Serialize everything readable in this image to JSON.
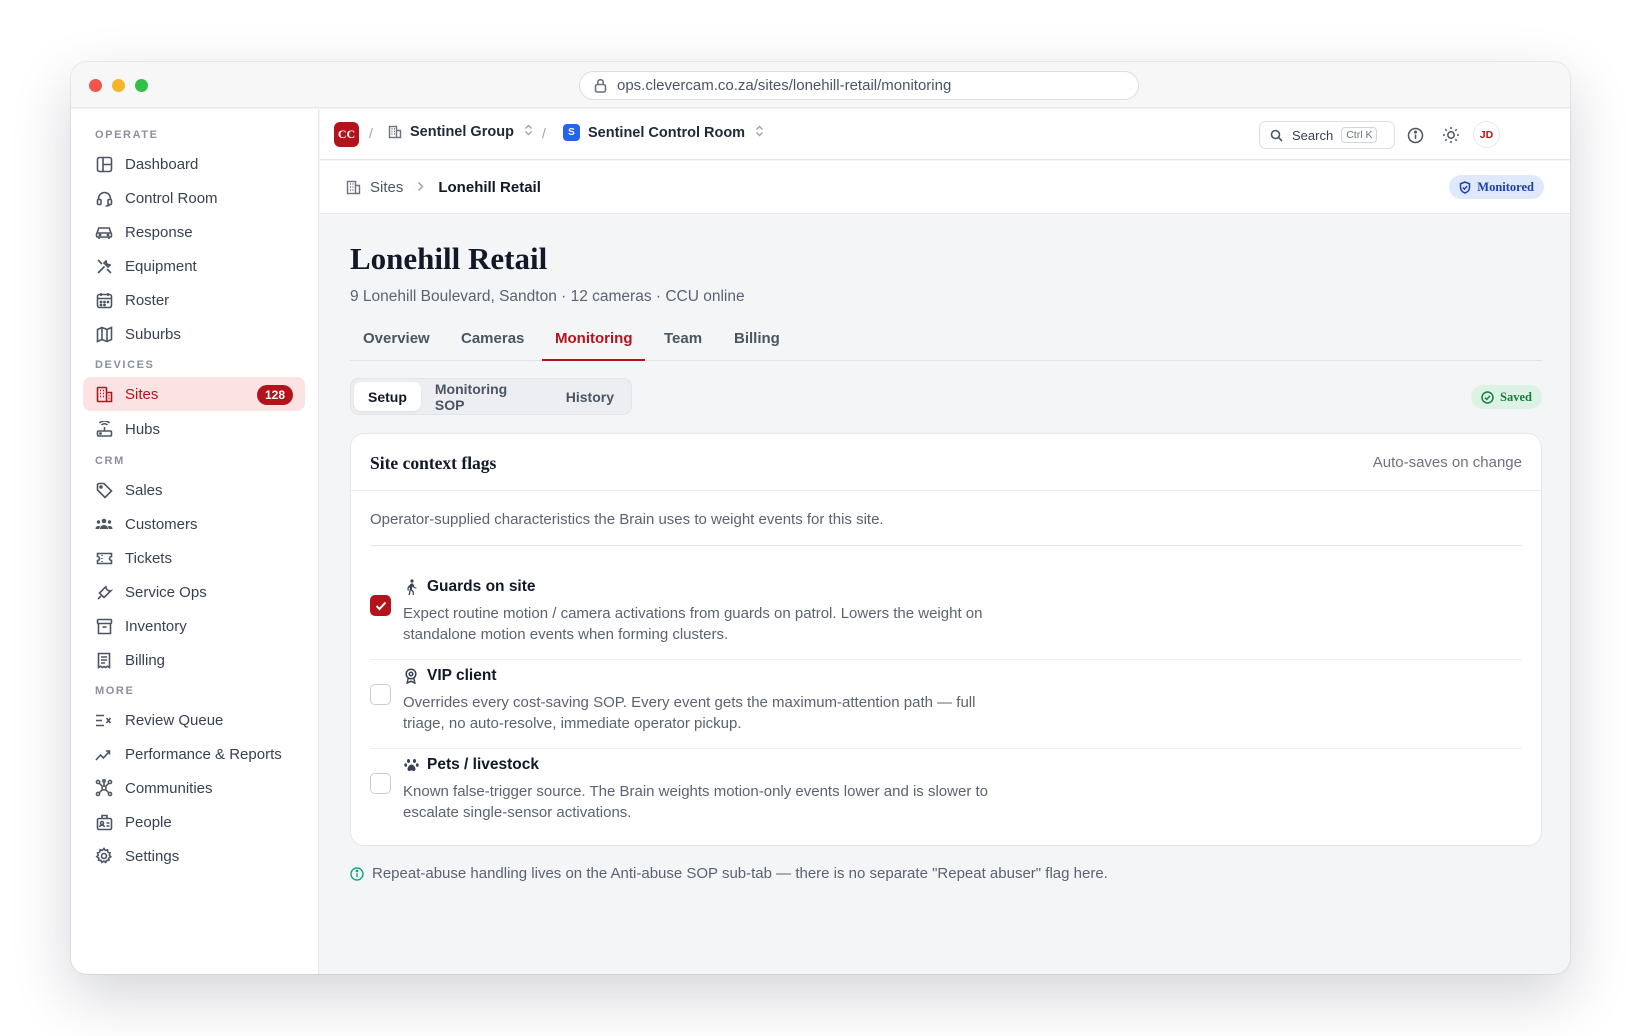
{
  "browser": {
    "url": "ops.clevercam.co.za/sites/lonehill-retail/monitoring"
  },
  "sidebar": {
    "sections": [
      {
        "label": "OPERATE",
        "items": [
          {
            "label": "Dashboard",
            "icon": "layout-icon"
          },
          {
            "label": "Control Room",
            "icon": "headset-icon"
          },
          {
            "label": "Response",
            "icon": "car-icon"
          },
          {
            "label": "Equipment",
            "icon": "tools-icon"
          },
          {
            "label": "Roster",
            "icon": "calendar-icon"
          },
          {
            "label": "Suburbs",
            "icon": "map-icon"
          }
        ]
      },
      {
        "label": "DEVICES",
        "items": [
          {
            "label": "Sites",
            "icon": "building-icon",
            "badge": "128",
            "active": true
          },
          {
            "label": "Hubs",
            "icon": "router-icon"
          }
        ]
      },
      {
        "label": "CRM",
        "items": [
          {
            "label": "Sales",
            "icon": "tag-icon"
          },
          {
            "label": "Customers",
            "icon": "users-icon"
          },
          {
            "label": "Tickets",
            "icon": "ticket-icon"
          },
          {
            "label": "Service Ops",
            "icon": "wrench-icon"
          },
          {
            "label": "Inventory",
            "icon": "archive-icon"
          },
          {
            "label": "Billing",
            "icon": "receipt-icon"
          }
        ]
      },
      {
        "label": "MORE",
        "items": [
          {
            "label": "Review Queue",
            "icon": "review-list-icon"
          },
          {
            "label": "Performance & Reports",
            "icon": "trend-icon"
          },
          {
            "label": "Communities",
            "icon": "network-icon"
          },
          {
            "label": "People",
            "icon": "id-badge-icon"
          },
          {
            "label": "Settings",
            "icon": "gear-icon"
          }
        ]
      }
    ]
  },
  "topbar": {
    "logo": "CC",
    "org": "Sentinel Group",
    "workspace_logo": "S",
    "workspace": "Sentinel Control Room",
    "search_label": "Search",
    "search_shortcut": "Ctrl K",
    "avatar": "JD"
  },
  "breadcrumb": {
    "parent": "Sites",
    "current": "Lonehill Retail"
  },
  "status_badge": "Monitored",
  "page": {
    "title": "Lonehill Retail",
    "subtitle": "9 Lonehill Boulevard, Sandton · 12 cameras · CCU online"
  },
  "tabs": [
    {
      "label": "Overview"
    },
    {
      "label": "Cameras"
    },
    {
      "label": "Monitoring",
      "active": true
    },
    {
      "label": "Team"
    },
    {
      "label": "Billing"
    }
  ],
  "subtabs": [
    {
      "label": "Setup",
      "active": true
    },
    {
      "label": "Monitoring SOP"
    },
    {
      "label": "History"
    }
  ],
  "saved_badge": "Saved",
  "card": {
    "title": "Site context flags",
    "note": "Auto-saves on change",
    "description": "Operator-supplied characteristics the Brain uses to weight events for this site.",
    "flags": [
      {
        "title": "Guards on site",
        "icon": "walking-person-icon",
        "checked": true,
        "description": "Expect routine motion / camera activations from guards on patrol. Lowers the weight on standalone motion events when forming clusters."
      },
      {
        "title": "VIP client",
        "icon": "award-icon",
        "checked": false,
        "description": "Overrides every cost-saving SOP. Every event gets the maximum-attention path — full triage, no auto-resolve, immediate operator pickup."
      },
      {
        "title": "Pets / livestock",
        "icon": "paw-icon",
        "checked": false,
        "description": "Known false-trigger source. The Brain weights motion-only events lower and is slower to escalate single-sensor activations."
      }
    ]
  },
  "footnote": "Repeat-abuse handling lives on the Anti-abuse SOP sub-tab — there is no separate \"Repeat abuser\" flag here.",
  "colors": {
    "accent": "#b3141c",
    "info": "#1e40af",
    "success": "#15803d",
    "workspace": "#2563eb"
  }
}
